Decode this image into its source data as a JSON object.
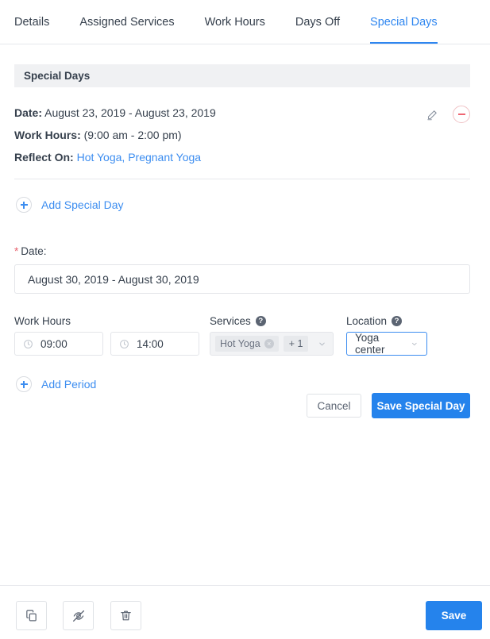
{
  "tabs": [
    {
      "label": "Details",
      "active": false
    },
    {
      "label": "Assigned Services",
      "active": false
    },
    {
      "label": "Work Hours",
      "active": false
    },
    {
      "label": "Days Off",
      "active": false
    },
    {
      "label": "Special Days",
      "active": true
    }
  ],
  "panel": {
    "header": "Special Days"
  },
  "entry": {
    "date_label": "Date:",
    "date_value": "August 23, 2019 - August 23, 2019",
    "work_hours_label": "Work Hours:",
    "work_hours_value": "(9:00 am - 2:00 pm)",
    "reflect_on_label": "Reflect On:",
    "reflect_on_value": "Hot Yoga, Pregnant Yoga",
    "edit_icon": "pencil-icon",
    "remove_icon": "minus-circle-icon"
  },
  "add_special_day": {
    "label": "Add Special Day",
    "icon": "plus-circle-icon"
  },
  "form": {
    "date": {
      "required_mark": "*",
      "label": "Date:",
      "value": "August 30, 2019 - August 30, 2019"
    },
    "work_hours": {
      "label": "Work Hours",
      "start": "09:00",
      "end": "14:00",
      "icon": "clock-icon"
    },
    "services": {
      "label": "Services",
      "help_icon": "help-icon",
      "help_glyph": "?",
      "chip": "Hot Yoga",
      "chip_remove": "×",
      "more": "+ 1",
      "caret_icon": "chevron-down-icon"
    },
    "location": {
      "label": "Location",
      "help_icon": "help-icon",
      "help_glyph": "?",
      "value": "Yoga center",
      "caret_icon": "chevron-down-icon"
    },
    "add_period": {
      "label": "Add Period",
      "icon": "plus-circle-icon"
    },
    "cancel_label": "Cancel",
    "save_special_day_label": "Save Special Day"
  },
  "bottom_bar": {
    "duplicate_icon": "copy-icon",
    "hide_icon": "eye-off-icon",
    "delete_icon": "trash-icon",
    "save_label": "Save"
  },
  "colors": {
    "accent": "#2e86f0",
    "link": "#3c8df0",
    "primary_button": "#2583ec",
    "danger": "#ef6673",
    "text": "#36404d",
    "header_bar": "#f0f1f3",
    "border": "#e3e5e9"
  }
}
